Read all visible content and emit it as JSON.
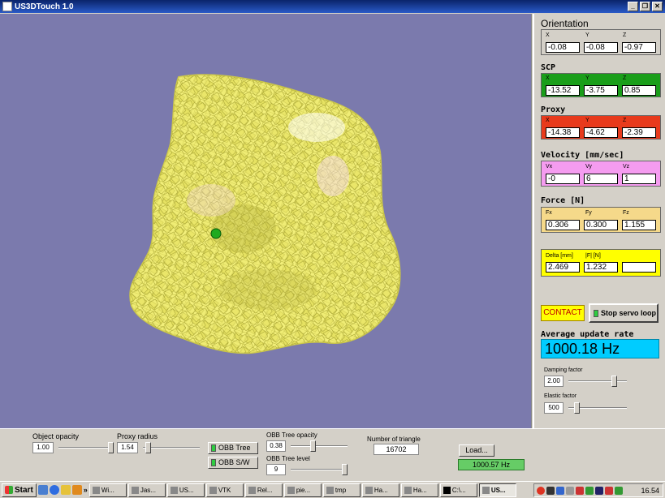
{
  "window": {
    "title": "US3DTouch 1.0",
    "buttons": [
      "_",
      "❐",
      "✕"
    ]
  },
  "orientation": {
    "title": "Orientation",
    "labels": [
      "X",
      "Y",
      "Z"
    ],
    "values": [
      "-0.08",
      "-0.08",
      "-0.97"
    ],
    "color": "#d4d0c8"
  },
  "scp": {
    "title": "SCP",
    "labels": [
      "X",
      "Y",
      "Z"
    ],
    "values": [
      "-13.52",
      "-3.75",
      "0.85"
    ],
    "color": "#1a9e1a"
  },
  "proxy": {
    "title": "Proxy",
    "labels": [
      "X",
      "Y",
      "Z"
    ],
    "values": [
      "-14.38",
      "-4.62",
      "-2.39"
    ],
    "color": "#e83a1c"
  },
  "velocity": {
    "title": "Velocity [mm/sec]",
    "labels": [
      "Vx",
      "Vy",
      "Vz"
    ],
    "values": [
      "-0",
      "6",
      "1"
    ],
    "color": "#f59cf0"
  },
  "force": {
    "title": "Force [N]",
    "labels": [
      "Fx",
      "Fy",
      "Fz"
    ],
    "values": [
      "0.306",
      "0.300",
      "1.155"
    ],
    "color": "#f5d98a"
  },
  "delta": {
    "labels": [
      "Delta [mm]",
      "|F| [N]",
      ""
    ],
    "values": [
      "2.469",
      "1.232",
      ""
    ],
    "color": "#ffff00"
  },
  "contact": {
    "label": "CONTACT"
  },
  "stop_button": {
    "label": "Stop servo loop"
  },
  "rate": {
    "title": "Average update rate",
    "value": "1000.18 Hz"
  },
  "damping": {
    "label": "Damping factor",
    "value": "2.00",
    "level": 0.82
  },
  "elastic": {
    "label": "Elastic factor",
    "value": "500",
    "level": 0.1
  },
  "bottom": {
    "object_opacity": {
      "label": "Object opacity",
      "value": "1.00",
      "level": 1.0
    },
    "proxy_radius": {
      "label": "Proxy radius",
      "value": "1.54",
      "level": 0.05
    },
    "obb_tree_button": "OBB Tree",
    "obb_sw_button": "OBB S/W",
    "obb_opacity": {
      "label": "OBB Tree  opacity",
      "value": "0.38",
      "level": 0.38
    },
    "obb_level": {
      "label": "OBB Tree  level",
      "value": "9",
      "level": 1.0
    },
    "triangles": {
      "label": "Number of triangle",
      "value": "16702"
    },
    "load_button": "Load...",
    "hz": "1000.57 Hz"
  },
  "taskbar": {
    "start": "Start",
    "tasks": [
      "Wi...",
      "Jas...",
      "US...",
      "VTK",
      "Rel...",
      "pie...",
      "tmp",
      "Ha...",
      "Ha...",
      "C:\\...",
      "US..."
    ],
    "clock": "16.54"
  }
}
